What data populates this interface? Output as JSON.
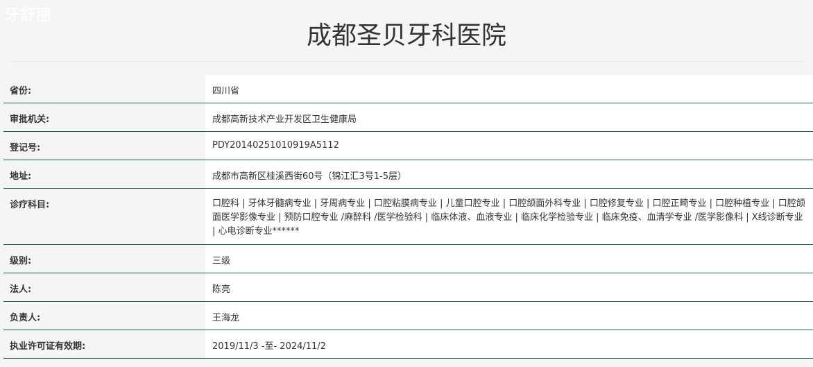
{
  "watermark": "牙舒丽",
  "page": {
    "title": "成都圣贝牙科医院"
  },
  "rows": [
    {
      "label": "省份:",
      "value": "四川省"
    },
    {
      "label": "审批机关:",
      "value": "成都高新技术产业开发区卫生健康局"
    },
    {
      "label": "登记号:",
      "value": "PDY20140251010919A5112"
    },
    {
      "label": "地址:",
      "value": "成都市高新区桂溪西街60号（锦江汇3号1-5层）"
    },
    {
      "label": "诊疗科目:",
      "value": "口腔科 | 牙体牙髓病专业 | 牙周病专业 | 口腔粘膜病专业 | 儿童口腔专业 | 口腔颌面外科专业 | 口腔修复专业 | 口腔正畸专业 | 口腔种植专业 | 口腔颌面医学影像专业 | 预防口腔专业 /麻醉科 /医学检验科 | 临床体液、血液专业 | 临床化学检验专业 | 临床免疫、血清学专业 /医学影像科 | X线诊断专业 | 心电诊断专业******"
    },
    {
      "label": "级别:",
      "value": "三级"
    },
    {
      "label": "法人:",
      "value": "陈亮"
    },
    {
      "label": "负责人:",
      "value": "王海龙"
    },
    {
      "label": "执业许可证有效期:",
      "value": "2019/11/3 -至- 2024/11/2"
    }
  ]
}
